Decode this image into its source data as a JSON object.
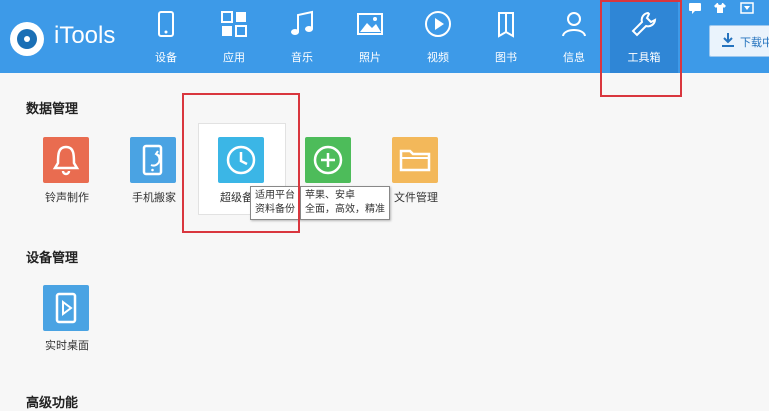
{
  "app": {
    "title": "iTools"
  },
  "nav": {
    "items": [
      {
        "label": "设备",
        "icon": "device-icon"
      },
      {
        "label": "应用",
        "icon": "apps-icon"
      },
      {
        "label": "音乐",
        "icon": "music-icon"
      },
      {
        "label": "照片",
        "icon": "photo-icon"
      },
      {
        "label": "视频",
        "icon": "video-icon"
      },
      {
        "label": "图书",
        "icon": "book-icon"
      },
      {
        "label": "信息",
        "icon": "contact-icon"
      },
      {
        "label": "工具箱",
        "icon": "wrench-icon"
      }
    ],
    "active": "工具箱",
    "download_label": "下载中"
  },
  "sections": {
    "data_mgmt": {
      "title": "数据管理",
      "tools": [
        {
          "label": "铃声制作",
          "icon": "bell-icon",
          "color": "#e96c50"
        },
        {
          "label": "手机搬家",
          "icon": "phone-transfer-icon",
          "color": "#4aa3e3"
        },
        {
          "label": "超级备份",
          "icon": "clock-backup-icon",
          "color": "#3bb6e6"
        },
        {
          "label": "",
          "icon": "plus-circle-icon",
          "color": "#4dbc5a"
        },
        {
          "label": "文件管理",
          "icon": "folder-icon",
          "color": "#f3b85a"
        }
      ]
    },
    "device_mgmt": {
      "title": "设备管理",
      "tools": [
        {
          "label": "实时桌面",
          "icon": "play-screen-icon",
          "color": "#4aa3e3"
        }
      ]
    },
    "advanced": {
      "title": "高级功能"
    }
  },
  "tooltips": {
    "backup": {
      "line1": "适用平台",
      "line2": "资料备份"
    },
    "platform": {
      "line1": "苹果、安卓",
      "line2": "全面，高效，精准"
    }
  },
  "colors": {
    "topbar": "#3d9ae8",
    "highlight": "#d9363e"
  }
}
